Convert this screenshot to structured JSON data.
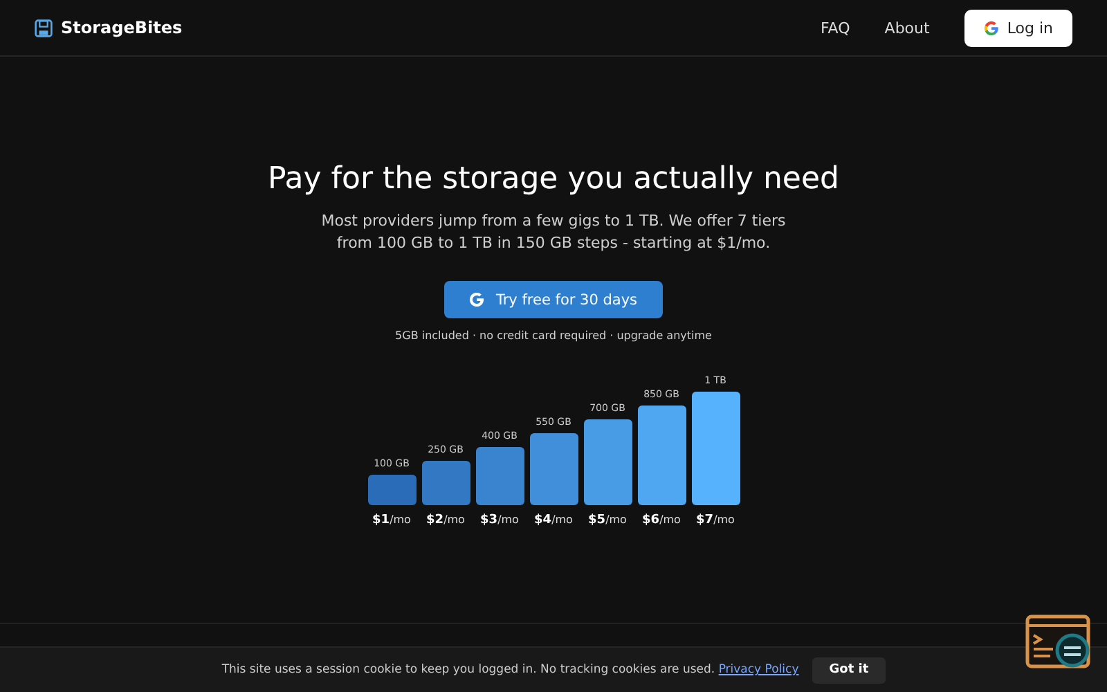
{
  "header": {
    "brand": "StorageBites",
    "nav": [
      "FAQ",
      "About"
    ],
    "login": "Log in"
  },
  "hero": {
    "title": "Pay for the storage you actually need",
    "subtitle_lines": [
      "Most providers jump from a few gigs to 1 TB. We offer 7 tiers",
      "from 100 GB to 1 TB in 150 GB steps - starting at $1/mo."
    ],
    "cta": "Try free for 30 days",
    "note": "5GB included · no credit card required · upgrade anytime"
  },
  "tiers": [
    {
      "size": "100 GB",
      "price": "**$1**/mo"
    },
    {
      "size": "250 GB",
      "price": "**$2**/mo"
    },
    {
      "size": "400 GB",
      "price": "**$3**/mo"
    },
    {
      "size": "550 GB",
      "price": "**$4**/mo"
    },
    {
      "size": "700 GB",
      "price": "**$5**/mo"
    },
    {
      "size": "850 GB",
      "price": "**$6**/mo"
    },
    {
      "size": "1 TB",
      "price": "**$7**/mo"
    }
  ],
  "cookie_bar": {
    "text": "This site uses a session cookie to keep you logged in. No tracking cookies are used.",
    "link": "Privacy Policy",
    "button": "Got it"
  }
}
